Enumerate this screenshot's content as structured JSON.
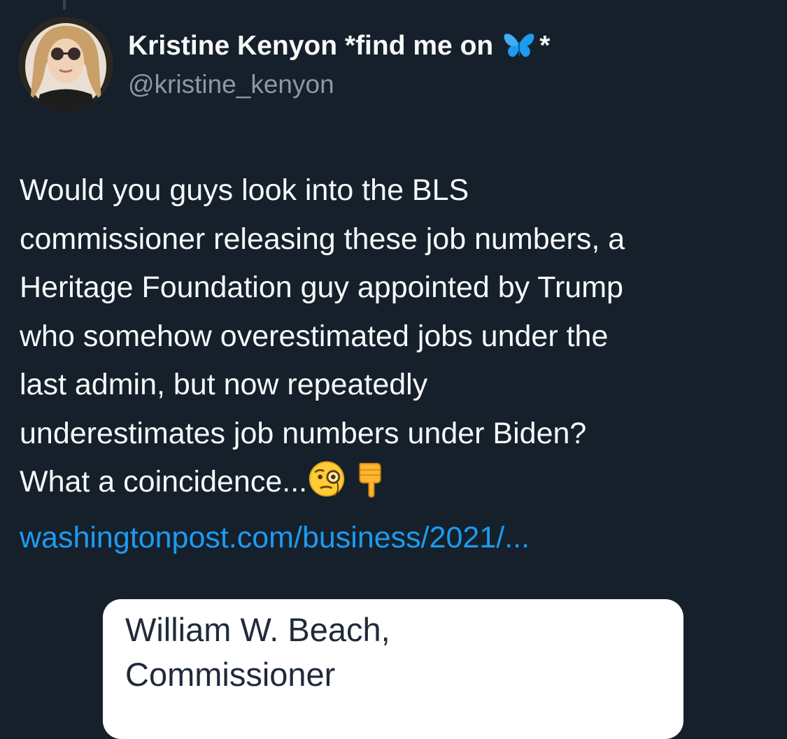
{
  "tweet": {
    "author": {
      "display_name_prefix": "Kristine Kenyon *find me on",
      "display_name_suffix": "*",
      "name_icon": "butterfly-icon",
      "handle": "@kristine_kenyon"
    },
    "text_lines": [
      "Would you guys look into the BLS",
      "commissioner releasing these job numbers, a",
      "Heritage Foundation guy appointed by Trump",
      "who somehow overestimated jobs under the",
      "last admin, but now repeatedly",
      "underestimates job numbers under Biden?",
      "What a coincidence..."
    ],
    "emojis": [
      "monocle-face-icon",
      "pointing-down-icon"
    ],
    "link": "washingtonpost.com/business/2021/..."
  },
  "media_card": {
    "line1": "William W. Beach,",
    "line2": "Commissioner"
  },
  "colors": {
    "background": "#15202b",
    "text": "#f7f9f9",
    "secondary_text": "#8b98a5",
    "link": "#1d9bf0",
    "butterfly": "#1d9bf0"
  }
}
